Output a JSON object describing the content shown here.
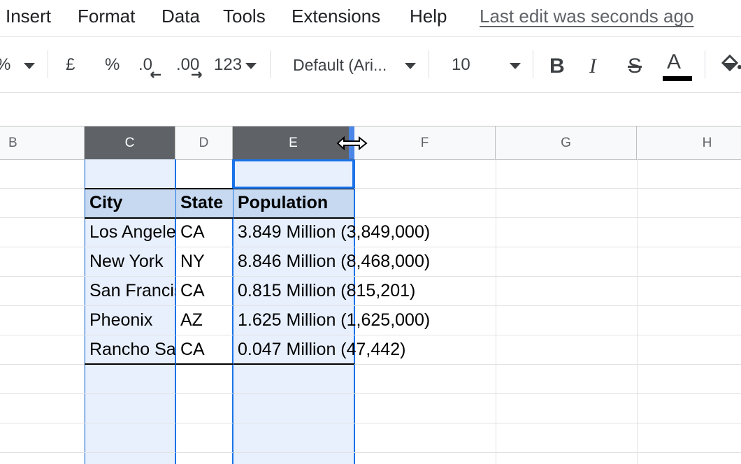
{
  "menu": {
    "items": [
      "Insert",
      "Format",
      "Data",
      "Tools",
      "Extensions",
      "Help"
    ],
    "last_edit": "Last edit was seconds ago"
  },
  "toolbar": {
    "percent_partial": "%",
    "currency": "£",
    "percent": "%",
    "decrease_decimal": ".0",
    "increase_decimal": ".00",
    "more_formats": "123",
    "font": "Default (Ari...",
    "font_size": "10",
    "bold": "B",
    "italic": "I",
    "strikethrough": "S",
    "text_color": "A",
    "text_color_value": "#000000"
  },
  "columns": [
    "B",
    "C",
    "D",
    "E",
    "F",
    "G",
    "H"
  ],
  "selected_columns": [
    "C",
    "E"
  ],
  "table": {
    "headers": [
      "City",
      "State",
      "Population"
    ],
    "rows": [
      [
        "Los Angeles",
        "CA",
        "3.849 Million (3,849,000)"
      ],
      [
        "New York",
        "NY",
        "8.846 Million (8,468,000)"
      ],
      [
        "San Francisco",
        "CA",
        "0.815 Million (815,201)"
      ],
      [
        "Pheonix",
        "AZ",
        "1.625 Million (1,625,000)"
      ],
      [
        "Rancho Santa Margarita",
        "CA",
        "0.047 Million (47,442)"
      ]
    ]
  },
  "colors": {
    "selection_fill": "#e8f0fe",
    "selection_border": "#1a73e8",
    "header_fill": "#c6d9f1",
    "selected_header": "#5f6368"
  }
}
